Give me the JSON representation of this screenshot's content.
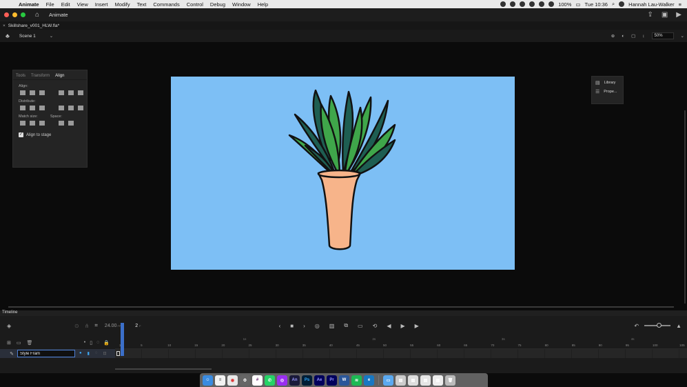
{
  "menubar": {
    "app_name": "Animate",
    "items": [
      "File",
      "Edit",
      "View",
      "Insert",
      "Modify",
      "Text",
      "Commands",
      "Control",
      "Debug",
      "Window",
      "Help"
    ],
    "battery": "100%",
    "clock": "Tue 10:36",
    "user": "Hannah Lau-Walker"
  },
  "titlebar": {
    "title": "Animate"
  },
  "document": {
    "tab_name": "Skillshare_v001_HLW.fla*"
  },
  "scenebar": {
    "scene": "Scene 1",
    "zoom": "50%"
  },
  "align_panel": {
    "tabs": [
      "Tools",
      "Transform",
      "Align"
    ],
    "active_tab": "Align",
    "align_label": "Align:",
    "distribute_label": "Distribute:",
    "match_size_label": "Match size:",
    "space_label": "Space:",
    "align_to_stage": "Align to stage"
  },
  "library_panel": {
    "items": [
      "Library",
      "Prope..."
    ]
  },
  "timeline": {
    "title": "Timeline",
    "fps": "24.00",
    "fps_unit": "FPS",
    "current_frame": "2",
    "frame_unit": "F",
    "layer_name": "Style Fram",
    "ruler_ticks": [
      "1",
      "5",
      "10",
      "15",
      "20",
      "25",
      "30",
      "35",
      "40",
      "45",
      "50",
      "55",
      "60",
      "65",
      "70",
      "75",
      "80",
      "85",
      "90",
      "95",
      "100",
      "105"
    ],
    "second_marks": [
      "1s",
      "2s",
      "3s",
      "4s"
    ]
  },
  "colors": {
    "stage": "#7dbff5",
    "accent": "#3b6fc9",
    "leaf_light": "#3fa64a",
    "leaf_dark": "#1e5e52",
    "vase": "#f7b48a"
  }
}
